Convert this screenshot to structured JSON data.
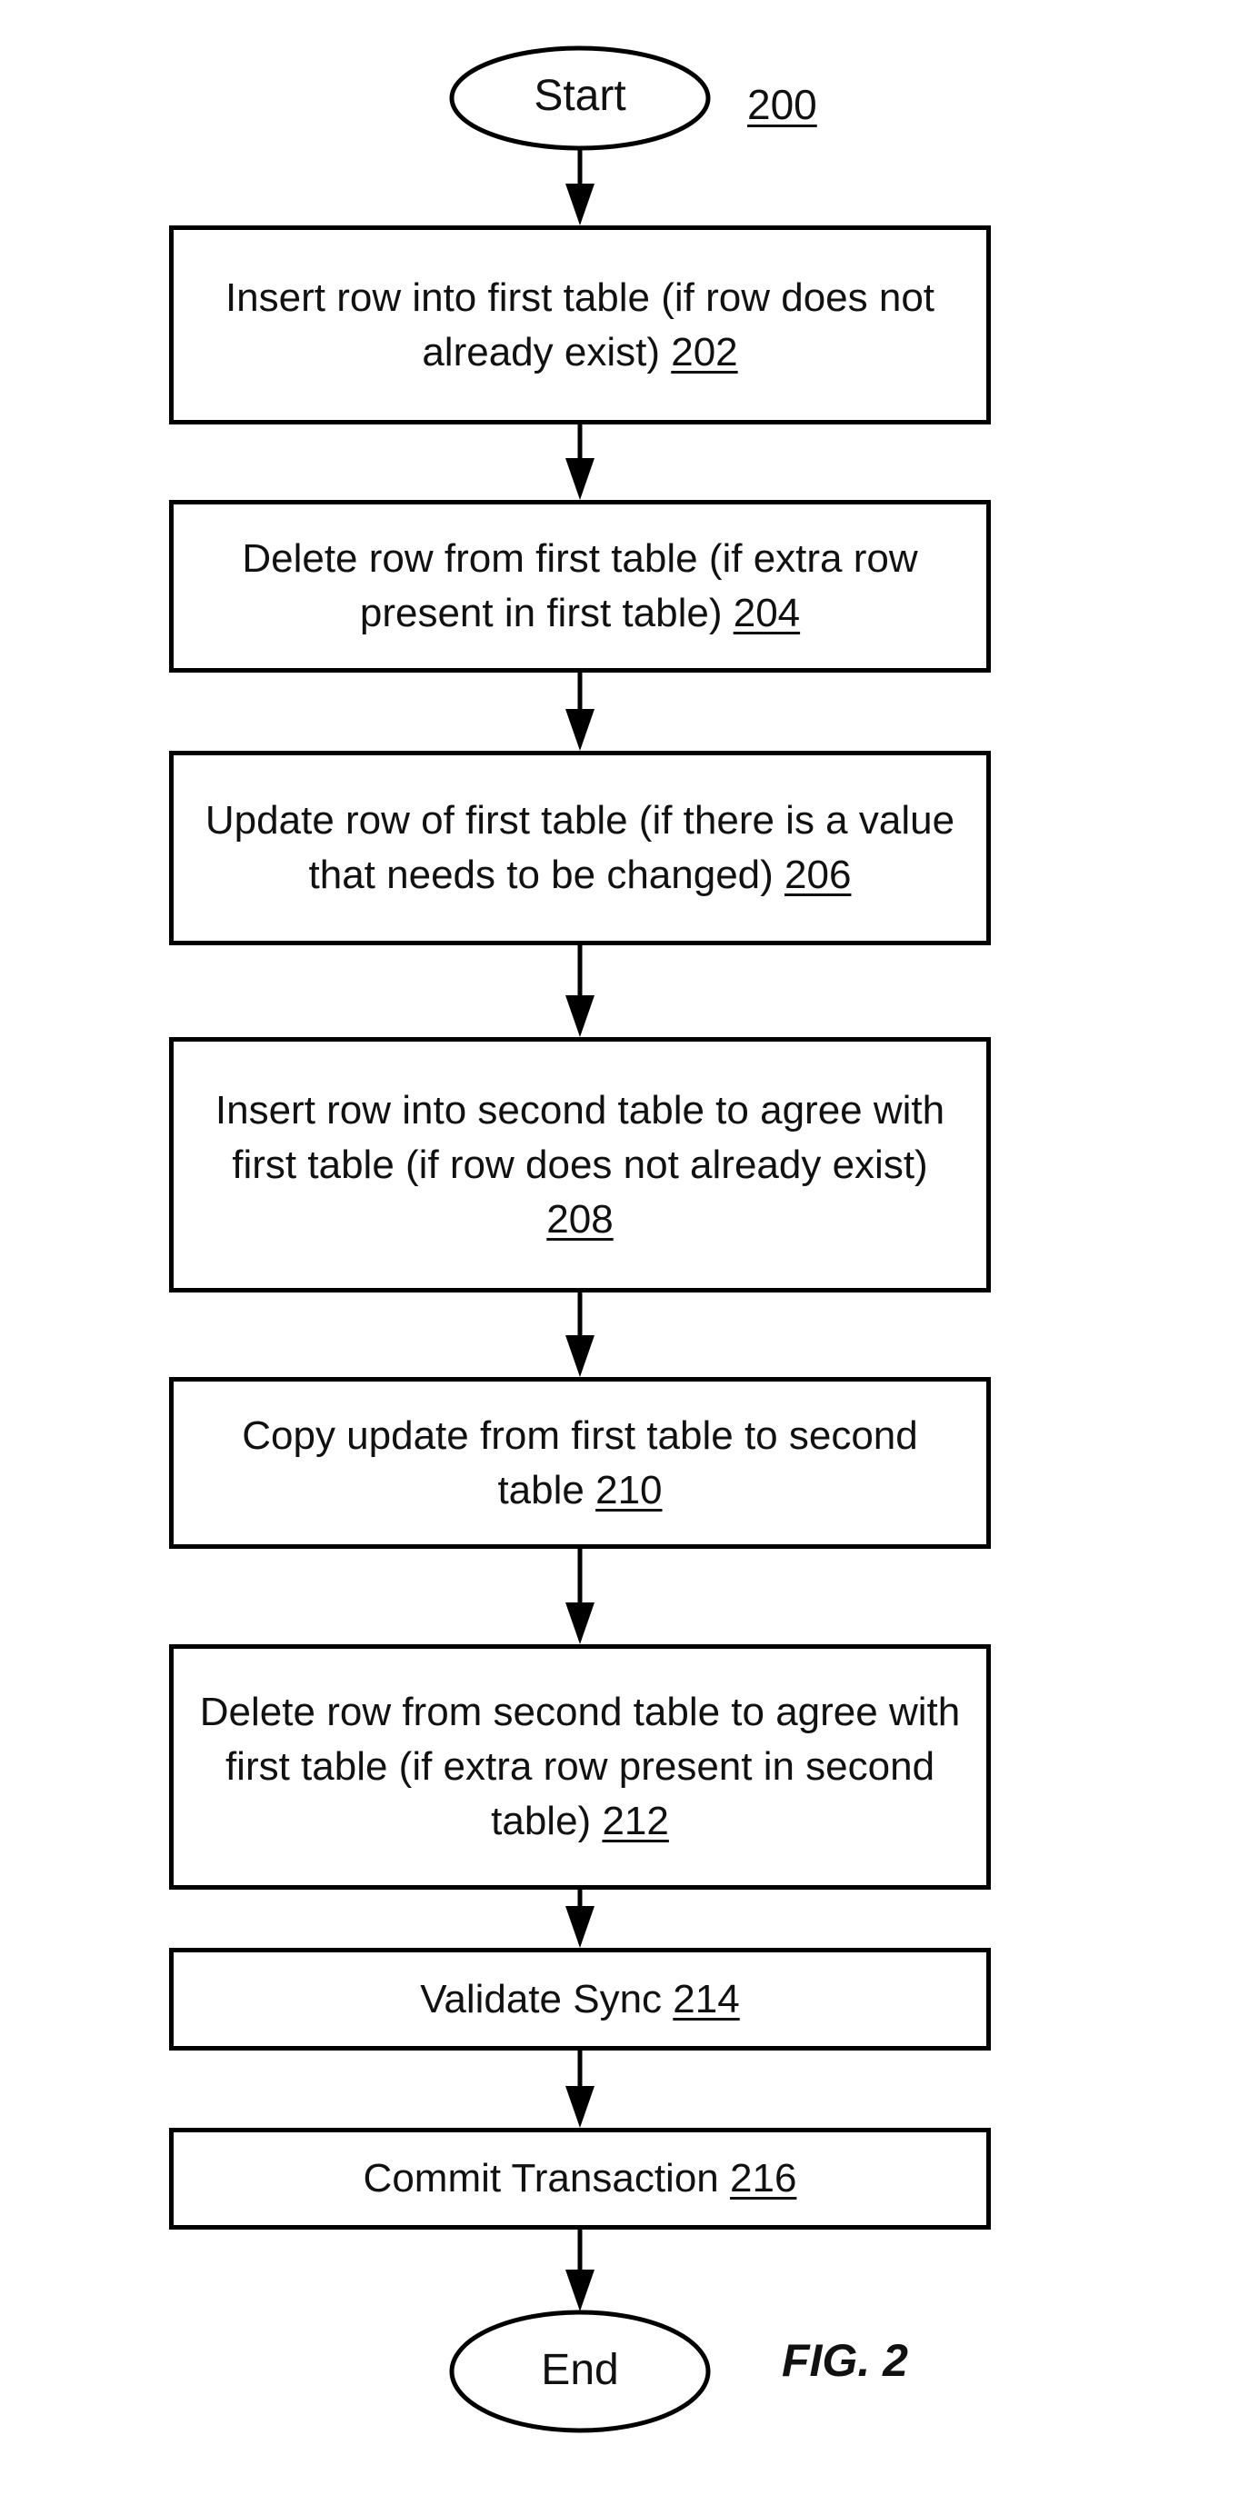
{
  "figure": {
    "ref_number": "200",
    "caption": "FIG. 2"
  },
  "start": {
    "label": "Start"
  },
  "end": {
    "label": "End"
  },
  "steps": [
    {
      "text": "Insert row into first table (if row does not already exist)",
      "ref": "202"
    },
    {
      "text": "Delete row from first table (if extra row present in first table)",
      "ref": "204"
    },
    {
      "text": "Update row of first table (if there is a value that needs to be changed)",
      "ref": "206"
    },
    {
      "text": "Insert row into second table to agree with first table (if row does not already exist)",
      "ref": "208"
    },
    {
      "text": "Copy update from first table to second table",
      "ref": "210"
    },
    {
      "text": "Delete row from second table to agree with first table (if extra row present in second table)",
      "ref": "212"
    },
    {
      "text": "Validate Sync",
      "ref": "214"
    },
    {
      "text": "Commit Transaction",
      "ref": "216"
    }
  ],
  "colors": {
    "stroke": "#000000",
    "background": "#ffffff"
  }
}
